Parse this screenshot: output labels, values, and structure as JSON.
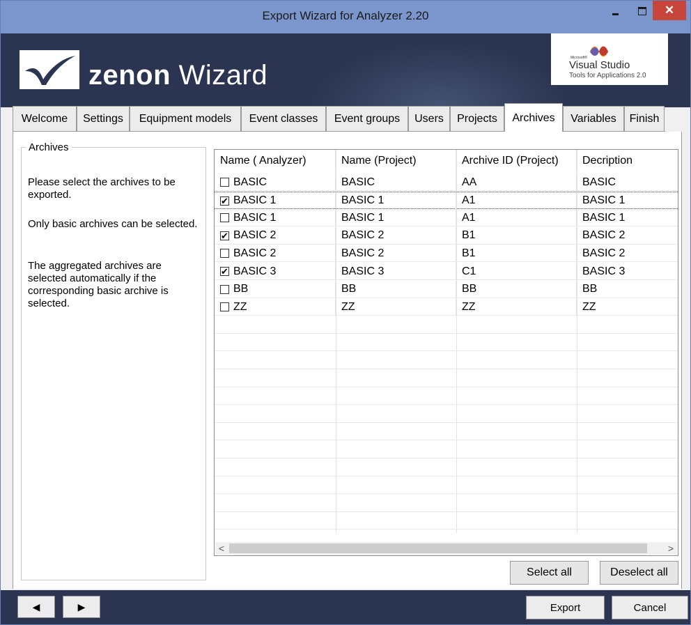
{
  "window": {
    "title": "Export Wizard for Analyzer 2.20",
    "minimize_icon": "minimize-icon",
    "maximize_icon": "maximize-icon",
    "close_glyph": "✕"
  },
  "banner": {
    "brand_bold": "zenon",
    "brand_rest": " Wizard",
    "vs_small": "Microsoft®",
    "vs_name": "Visual Studio",
    "vs_sub": "Tools for Applications 2.0"
  },
  "tabs": [
    {
      "label": "Welcome"
    },
    {
      "label": "Settings"
    },
    {
      "label": "Equipment models"
    },
    {
      "label": "Event classes"
    },
    {
      "label": "Event groups"
    },
    {
      "label": "Users"
    },
    {
      "label": "Projects"
    },
    {
      "label": "Archives"
    },
    {
      "label": "Variables"
    },
    {
      "label": "Finish"
    }
  ],
  "active_tab": "Archives",
  "group": {
    "title": "Archives",
    "info1": "Please select the archives to be exported.",
    "info2": "Only basic archives can be selected.",
    "info3": "The aggregated archives are selected automatically if the corresponding basic archive is selected."
  },
  "grid": {
    "columns": [
      "Name ( Analyzer)",
      "Name (Project)",
      "Archive ID (Project)",
      "Decription"
    ],
    "rows": [
      {
        "checked": false,
        "analyzer": "BASIC",
        "project": "BASIC",
        "archive_id": "AA",
        "description": "BASIC"
      },
      {
        "checked": true,
        "analyzer": "BASIC 1",
        "project": "BASIC 1",
        "archive_id": "A1",
        "description": "BASIC 1"
      },
      {
        "checked": false,
        "analyzer": "BASIC 1",
        "project": "BASIC 1",
        "archive_id": "A1",
        "description": "BASIC 1"
      },
      {
        "checked": true,
        "analyzer": "BASIC 2",
        "project": "BASIC 2",
        "archive_id": "B1",
        "description": "BASIC 2"
      },
      {
        "checked": false,
        "analyzer": "BASIC 2",
        "project": "BASIC 2",
        "archive_id": "B1",
        "description": "BASIC 2"
      },
      {
        "checked": true,
        "analyzer": "BASIC 3",
        "project": "BASIC 3",
        "archive_id": "C1",
        "description": "BASIC 3"
      },
      {
        "checked": false,
        "analyzer": "BB",
        "project": "BB",
        "archive_id": "BB",
        "description": "BB"
      },
      {
        "checked": false,
        "analyzer": "ZZ",
        "project": "ZZ",
        "archive_id": "ZZ",
        "description": "ZZ"
      }
    ],
    "scroll_left": "<",
    "scroll_right": ">"
  },
  "buttons": {
    "select_all": "Select all",
    "deselect_all": "Deselect all",
    "back": "◀",
    "forward": "▶",
    "export": "Export",
    "cancel": "Cancel"
  }
}
